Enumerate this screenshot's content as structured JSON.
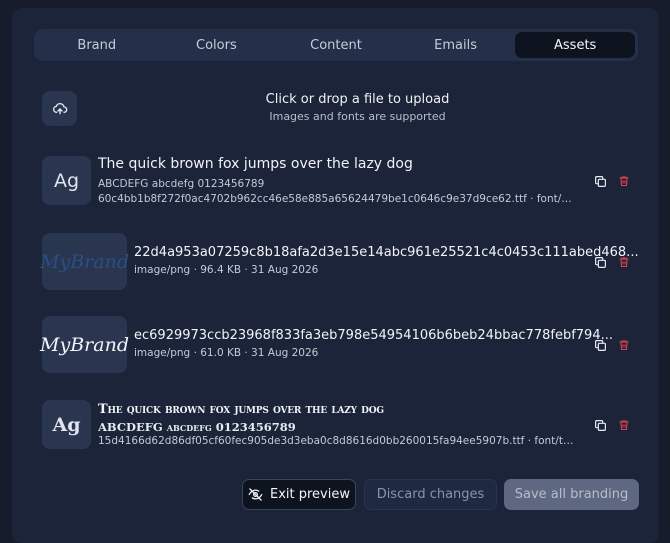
{
  "tabs": [
    {
      "label": "Brand"
    },
    {
      "label": "Colors"
    },
    {
      "label": "Content"
    },
    {
      "label": "Emails"
    },
    {
      "label": "Assets",
      "active": true
    }
  ],
  "upload": {
    "title": "Click or drop a file to upload",
    "subtitle": "Images and fonts are supported",
    "icon": "upload-cloud-icon"
  },
  "assets": [
    {
      "thumb": "Ag",
      "preview": "The quick brown fox jumps over the lazy dog",
      "sample": "ABCDEFG abcdefg 0123456789",
      "meta": "60c4bb1b8f272f0ac4702b962cc46e58e885a65624479be1c0646c9e37d9ce62.ttf · font/ttf · 1..."
    },
    {
      "thumb_text": "MyBrand",
      "name": "22d4a953a07259c8b18afa2d3e15e14abc961e25521c4c0453c111abed468...",
      "meta": "image/png · 96.4 KB · 31 Aug 2026"
    },
    {
      "thumb_text": "MyBrand",
      "name": "ec6929973ccb23968f833fa3eb798e54954106b6beb24bbac778febf794...",
      "meta": "image/png · 61.0 KB · 31 Aug 2026"
    },
    {
      "thumb": "Ag",
      "preview": "The quick brown fox jumps over the lazy dog",
      "sample": "ABCDEFG abcdefg 0123456789",
      "meta": "15d4166d62d86df05cf60fec905de3d3eba0c8d8616d0bb260015fa94ee5907b.ttf · font/ttf · 4..."
    }
  ],
  "footer": {
    "exit_label": "Exit preview",
    "discard_label": "Discard changes",
    "save_label": "Save all branding"
  },
  "colors": {
    "delete": "#e0414a",
    "accent_active_tab": "#0e1320"
  }
}
